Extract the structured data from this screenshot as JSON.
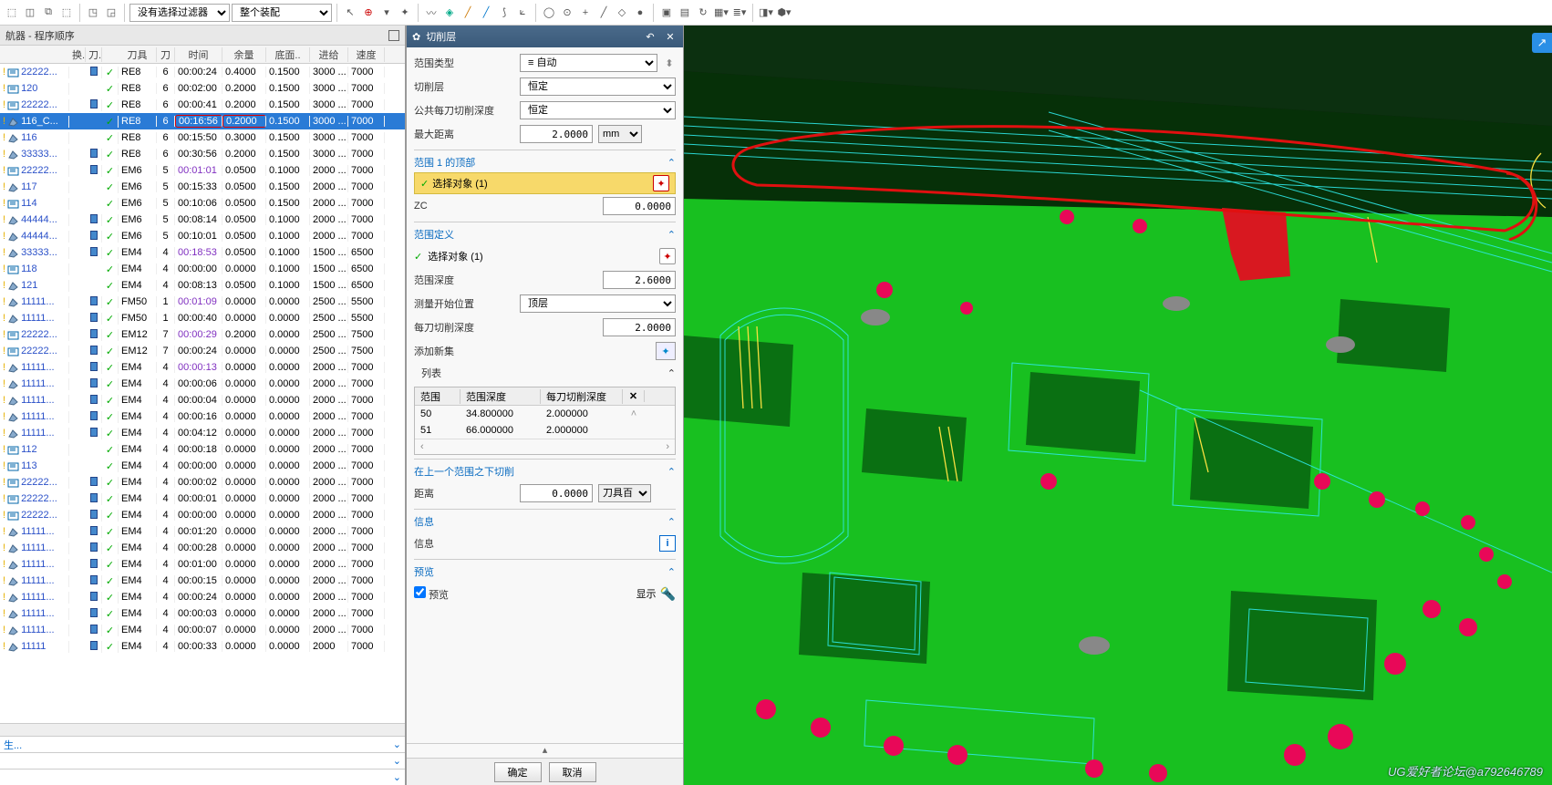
{
  "toolbar": {
    "filter_label": "没有选择过滤器",
    "assembly_label": "整个装配"
  },
  "navigator": {
    "title": "航器 - 程序顺序",
    "columns": {
      "swap": "换.",
      "dao": "刀..",
      "tool": "刀具",
      "diam": "刀",
      "time": "时间",
      "stock": "余量",
      "floor": "底面..",
      "feed": "进给",
      "speed": "速度"
    },
    "footer": "生...",
    "rows": [
      {
        "name": "22222...",
        "icon": "p",
        "warn": true,
        "dao": "b",
        "chk": true,
        "tool": "RE8",
        "diam": "6",
        "time": "00:00:24",
        "stock": "0.4000",
        "floor": "0.1500",
        "feed": "3000 ...",
        "speed": "7000",
        "link": false
      },
      {
        "name": "120",
        "icon": "p",
        "warn": true,
        "dao": "",
        "chk": true,
        "tool": "RE8",
        "diam": "6",
        "time": "00:02:00",
        "stock": "0.2000",
        "floor": "0.1500",
        "feed": "3000 ...",
        "speed": "7000",
        "link": false
      },
      {
        "name": "22222...",
        "icon": "p",
        "warn": true,
        "dao": "b",
        "chk": true,
        "tool": "RE8",
        "diam": "6",
        "time": "00:00:41",
        "stock": "0.2000",
        "floor": "0.1500",
        "feed": "3000 ...",
        "speed": "7000",
        "link": false
      },
      {
        "name": "116_C...",
        "icon": "s",
        "warn": true,
        "dao": "",
        "chk": true,
        "tool": "RE8",
        "diam": "6",
        "time": "00:16:56",
        "stock": "0.2000",
        "floor": "0.1500",
        "feed": "3000 ...",
        "speed": "7000",
        "sel": true,
        "redbox": true
      },
      {
        "name": "116",
        "icon": "s",
        "warn": true,
        "dao": "",
        "chk": true,
        "tool": "RE8",
        "diam": "6",
        "time": "00:15:50",
        "stock": "0.3000",
        "floor": "0.1500",
        "feed": "3000 ...",
        "speed": "7000",
        "link": false
      },
      {
        "name": "33333...",
        "icon": "s",
        "warn": true,
        "dao": "b",
        "chk": true,
        "tool": "RE8",
        "diam": "6",
        "time": "00:30:56",
        "stock": "0.2000",
        "floor": "0.1500",
        "feed": "3000 ...",
        "speed": "7000",
        "link": false
      },
      {
        "name": "22222...",
        "icon": "p",
        "warn": true,
        "dao": "b",
        "chk": true,
        "tool": "EM6",
        "diam": "5",
        "time": "00:01:01",
        "stock": "0.0500",
        "floor": "0.1000",
        "feed": "2000 ...",
        "speed": "7000",
        "link": true,
        "purple": true
      },
      {
        "name": "117",
        "icon": "s",
        "warn": true,
        "dao": "",
        "chk": true,
        "tool": "EM6",
        "diam": "5",
        "time": "00:15:33",
        "stock": "0.0500",
        "floor": "0.1500",
        "feed": "2000 ...",
        "speed": "7000",
        "link": false
      },
      {
        "name": "114",
        "icon": "p",
        "warn": true,
        "dao": "",
        "chk": true,
        "tool": "EM6",
        "diam": "5",
        "time": "00:10:06",
        "stock": "0.0500",
        "floor": "0.1500",
        "feed": "2000 ...",
        "speed": "7000",
        "link": false
      },
      {
        "name": "44444...",
        "icon": "s",
        "warn": true,
        "dao": "b",
        "chk": true,
        "tool": "EM6",
        "diam": "5",
        "time": "00:08:14",
        "stock": "0.0500",
        "floor": "0.1000",
        "feed": "2000 ...",
        "speed": "7000",
        "link": false
      },
      {
        "name": "44444...",
        "icon": "s",
        "warn": true,
        "dao": "b",
        "chk": true,
        "tool": "EM6",
        "diam": "5",
        "time": "00:10:01",
        "stock": "0.0500",
        "floor": "0.1000",
        "feed": "2000 ...",
        "speed": "7000",
        "link": false
      },
      {
        "name": "33333...",
        "icon": "s",
        "warn": true,
        "dao": "b",
        "chk": true,
        "tool": "EM4",
        "diam": "4",
        "time": "00:18:53",
        "stock": "0.0500",
        "floor": "0.1000",
        "feed": "1500 ...",
        "speed": "6500",
        "link": true,
        "purple": true
      },
      {
        "name": "118",
        "icon": "p",
        "warn": true,
        "dao": "",
        "chk": true,
        "tool": "EM4",
        "diam": "4",
        "time": "00:00:00",
        "stock": "0.0000",
        "floor": "0.1000",
        "feed": "1500 ...",
        "speed": "6500",
        "link": false
      },
      {
        "name": "121",
        "icon": "s",
        "warn": true,
        "dao": "",
        "chk": true,
        "tool": "EM4",
        "diam": "4",
        "time": "00:08:13",
        "stock": "0.0500",
        "floor": "0.1000",
        "feed": "1500 ...",
        "speed": "6500",
        "link": false
      },
      {
        "name": "11111...",
        "icon": "s",
        "warn": true,
        "dao": "b",
        "chk": true,
        "tool": "FM50",
        "diam": "1",
        "time": "00:01:09",
        "stock": "0.0000",
        "floor": "0.0000",
        "feed": "2500 ...",
        "speed": "5500",
        "link": true,
        "purple": true
      },
      {
        "name": "11111...",
        "icon": "s",
        "warn": true,
        "dao": "b",
        "chk": true,
        "tool": "FM50",
        "diam": "1",
        "time": "00:00:40",
        "stock": "0.0000",
        "floor": "0.0000",
        "feed": "2500 ...",
        "speed": "5500",
        "link": false
      },
      {
        "name": "22222...",
        "icon": "p",
        "warn": true,
        "dao": "b",
        "chk": true,
        "tool": "EM12",
        "diam": "7",
        "time": "00:00:29",
        "stock": "0.2000",
        "floor": "0.0000",
        "feed": "2500 ...",
        "speed": "7500",
        "link": true,
        "purple": true
      },
      {
        "name": "22222...",
        "icon": "p",
        "warn": true,
        "dao": "b",
        "chk": true,
        "tool": "EM12",
        "diam": "7",
        "time": "00:00:24",
        "stock": "0.0000",
        "floor": "0.0000",
        "feed": "2500 ...",
        "speed": "7500",
        "link": false
      },
      {
        "name": "11111...",
        "icon": "s",
        "warn": true,
        "dao": "b",
        "chk": true,
        "tool": "EM4",
        "diam": "4",
        "time": "00:00:13",
        "stock": "0.0000",
        "floor": "0.0000",
        "feed": "2000 ...",
        "speed": "7000",
        "link": true,
        "purple": true
      },
      {
        "name": "11111...",
        "icon": "s",
        "warn": true,
        "dao": "b",
        "chk": true,
        "tool": "EM4",
        "diam": "4",
        "time": "00:00:06",
        "stock": "0.0000",
        "floor": "0.0000",
        "feed": "2000 ...",
        "speed": "7000",
        "link": false
      },
      {
        "name": "11111...",
        "icon": "s",
        "warn": true,
        "dao": "b",
        "chk": true,
        "tool": "EM4",
        "diam": "4",
        "time": "00:00:04",
        "stock": "0.0000",
        "floor": "0.0000",
        "feed": "2000 ...",
        "speed": "7000",
        "link": false
      },
      {
        "name": "11111...",
        "icon": "s",
        "warn": true,
        "dao": "b",
        "chk": true,
        "tool": "EM4",
        "diam": "4",
        "time": "00:00:16",
        "stock": "0.0000",
        "floor": "0.0000",
        "feed": "2000 ...",
        "speed": "7000",
        "link": false
      },
      {
        "name": "11111...",
        "icon": "s",
        "warn": true,
        "dao": "b",
        "chk": true,
        "tool": "EM4",
        "diam": "4",
        "time": "00:04:12",
        "stock": "0.0000",
        "floor": "0.0000",
        "feed": "2000 ...",
        "speed": "7000",
        "link": false
      },
      {
        "name": "112",
        "icon": "p",
        "warn": true,
        "dao": "",
        "chk": true,
        "tool": "EM4",
        "diam": "4",
        "time": "00:00:18",
        "stock": "0.0000",
        "floor": "0.0000",
        "feed": "2000 ...",
        "speed": "7000",
        "link": false
      },
      {
        "name": "113",
        "icon": "p",
        "warn": true,
        "dao": "",
        "chk": true,
        "tool": "EM4",
        "diam": "4",
        "time": "00:00:00",
        "stock": "0.0000",
        "floor": "0.0000",
        "feed": "2000 ...",
        "speed": "7000",
        "link": false
      },
      {
        "name": "22222...",
        "icon": "p",
        "warn": true,
        "dao": "b",
        "chk": true,
        "tool": "EM4",
        "diam": "4",
        "time": "00:00:02",
        "stock": "0.0000",
        "floor": "0.0000",
        "feed": "2000 ...",
        "speed": "7000",
        "link": false
      },
      {
        "name": "22222...",
        "icon": "p",
        "warn": true,
        "dao": "b",
        "chk": true,
        "tool": "EM4",
        "diam": "4",
        "time": "00:00:01",
        "stock": "0.0000",
        "floor": "0.0000",
        "feed": "2000 ...",
        "speed": "7000",
        "link": false
      },
      {
        "name": "22222...",
        "icon": "p",
        "warn": true,
        "dao": "b",
        "chk": true,
        "tool": "EM4",
        "diam": "4",
        "time": "00:00:00",
        "stock": "0.0000",
        "floor": "0.0000",
        "feed": "2000 ...",
        "speed": "7000",
        "link": false
      },
      {
        "name": "11111...",
        "icon": "s",
        "warn": true,
        "dao": "b",
        "chk": true,
        "tool": "EM4",
        "diam": "4",
        "time": "00:01:20",
        "stock": "0.0000",
        "floor": "0.0000",
        "feed": "2000 ...",
        "speed": "7000",
        "link": false
      },
      {
        "name": "11111...",
        "icon": "s",
        "warn": true,
        "dao": "b",
        "chk": true,
        "tool": "EM4",
        "diam": "4",
        "time": "00:00:28",
        "stock": "0.0000",
        "floor": "0.0000",
        "feed": "2000 ...",
        "speed": "7000",
        "link": false
      },
      {
        "name": "11111...",
        "icon": "s",
        "warn": true,
        "dao": "b",
        "chk": true,
        "tool": "EM4",
        "diam": "4",
        "time": "00:01:00",
        "stock": "0.0000",
        "floor": "0.0000",
        "feed": "2000 ...",
        "speed": "7000",
        "link": false
      },
      {
        "name": "11111...",
        "icon": "s",
        "warn": true,
        "dao": "b",
        "chk": true,
        "tool": "EM4",
        "diam": "4",
        "time": "00:00:15",
        "stock": "0.0000",
        "floor": "0.0000",
        "feed": "2000 ...",
        "speed": "7000",
        "link": false
      },
      {
        "name": "11111...",
        "icon": "s",
        "warn": true,
        "dao": "b",
        "chk": true,
        "tool": "EM4",
        "diam": "4",
        "time": "00:00:24",
        "stock": "0.0000",
        "floor": "0.0000",
        "feed": "2000 ...",
        "speed": "7000",
        "link": false
      },
      {
        "name": "11111...",
        "icon": "s",
        "warn": true,
        "dao": "b",
        "chk": true,
        "tool": "EM4",
        "diam": "4",
        "time": "00:00:03",
        "stock": "0.0000",
        "floor": "0.0000",
        "feed": "2000 ...",
        "speed": "7000",
        "link": false
      },
      {
        "name": "11111...",
        "icon": "s",
        "warn": true,
        "dao": "b",
        "chk": true,
        "tool": "EM4",
        "diam": "4",
        "time": "00:00:07",
        "stock": "0.0000",
        "floor": "0.0000",
        "feed": "2000 ...",
        "speed": "7000",
        "link": false
      },
      {
        "name": "11111",
        "icon": "s",
        "warn": true,
        "dao": "b",
        "chk": true,
        "tool": "EM4",
        "diam": "4",
        "time": "00:00:33",
        "stock": "0.0000",
        "floor": "0.0000",
        "feed": "2000",
        "speed": "7000",
        "link": false
      }
    ]
  },
  "dialog": {
    "title": "切削层",
    "range_type_label": "范围类型",
    "range_type_value": "自动",
    "cut_layer_label": "切削层",
    "cut_layer_value": "恒定",
    "common_depth_label": "公共每刀切削深度",
    "common_depth_value": "恒定",
    "max_dist_label": "最大距离",
    "max_dist_value": "2.0000",
    "max_dist_unit": "mm",
    "sect1_title": "范围 1 的顶部",
    "select_obj": "选择对象 (1)",
    "zc_label": "ZC",
    "zc_value": "0.0000",
    "sect2_title": "范围定义",
    "select_obj2": "选择对象 (1)",
    "range_depth_label": "范围深度",
    "range_depth_value": "2.6000",
    "measure_label": "测量开始位置",
    "measure_value": "顶层",
    "per_cut_label": "每刀切削深度",
    "per_cut_value": "2.0000",
    "add_set_label": "添加新集",
    "list_label": "列表",
    "table": {
      "h1": "范围",
      "h2": "范围深度",
      "h3": "每刀切削深度",
      "rows": [
        {
          "c1": "50",
          "c2": "34.800000",
          "c3": "2.000000"
        },
        {
          "c1": "51",
          "c2": "66.000000",
          "c3": "2.000000"
        }
      ]
    },
    "sect3_title": "在上一个范围之下切削",
    "distance_label": "距离",
    "distance_value": "0.0000",
    "distance_unit": "刀具百",
    "info_title": "信息",
    "info_label": "信息",
    "preview_title": "预览",
    "preview_check": "预览",
    "display_label": "显示",
    "ok": "确定",
    "cancel": "取消"
  },
  "watermark": "UG爱好者论坛@a792646789"
}
